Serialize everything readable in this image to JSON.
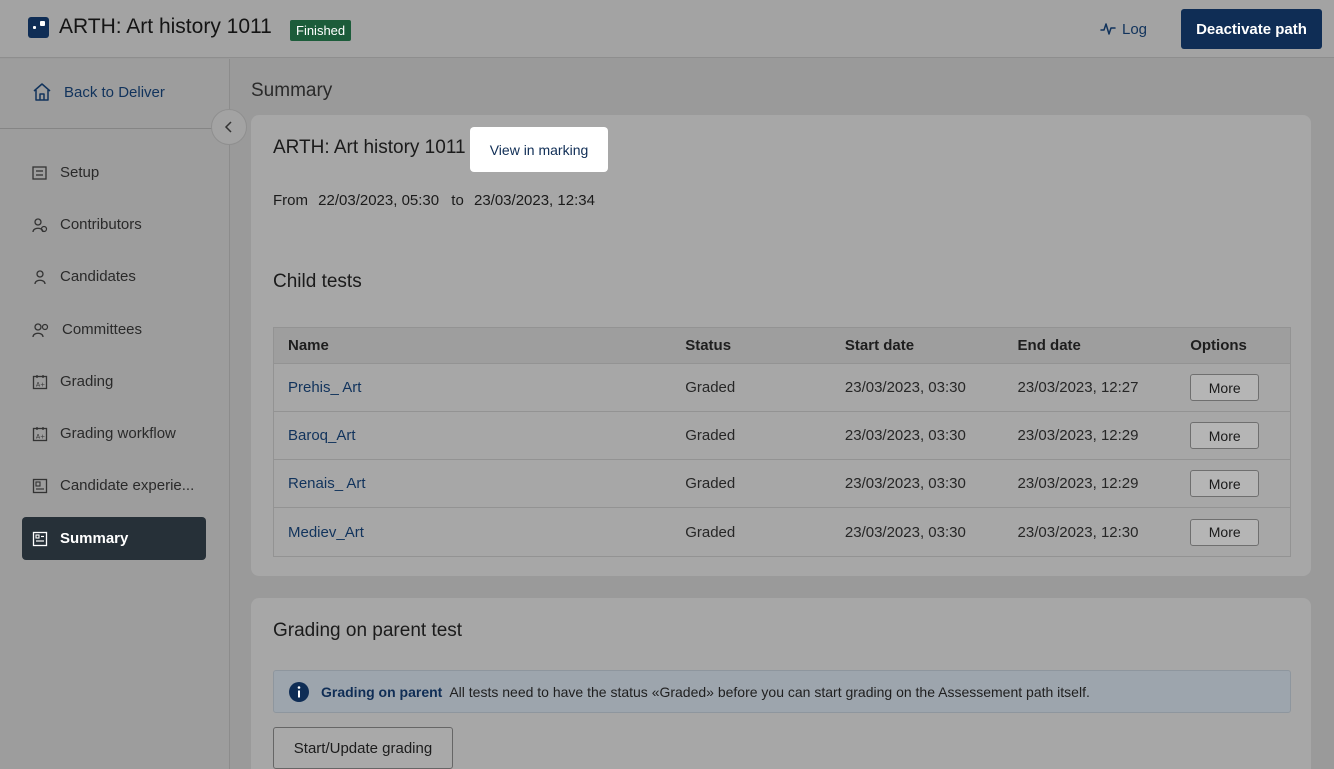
{
  "header": {
    "title": "ARTH: Art history 1011",
    "badge": "Finished",
    "log_label": "Log",
    "deactivate_label": "Deactivate path"
  },
  "sidebar": {
    "back_label": "Back to Deliver",
    "items": [
      {
        "label": "Setup",
        "icon": "setup-icon"
      },
      {
        "label": "Contributors",
        "icon": "contributors-icon"
      },
      {
        "label": "Candidates",
        "icon": "person-icon"
      },
      {
        "label": "Committees",
        "icon": "people-icon"
      },
      {
        "label": "Grading",
        "icon": "grading-calendar-icon"
      },
      {
        "label": "Grading workflow",
        "icon": "grading-calendar-icon"
      },
      {
        "label": "Candidate experie...",
        "icon": "candidate-experience-icon"
      },
      {
        "label": "Summary",
        "icon": "summary-icon",
        "active": true
      }
    ]
  },
  "main": {
    "title": "Summary",
    "test_card": {
      "title": "ARTH: Art history 1011",
      "view_marking_label": "View in marking",
      "from_label": "From",
      "from_date": "22/03/2023, 05:30",
      "to_label": "to",
      "to_date": "23/03/2023, 12:34"
    },
    "child_tests": {
      "heading": "Child tests",
      "columns": [
        "Name",
        "Status",
        "Start date",
        "End date",
        "Options"
      ],
      "rows": [
        {
          "name": "Prehis_ Art",
          "status": "Graded",
          "start": "23/03/2023, 03:30",
          "end": "23/03/2023, 12:27",
          "option": "More"
        },
        {
          "name": "Baroq_Art",
          "status": "Graded",
          "start": "23/03/2023, 03:30",
          "end": "23/03/2023, 12:29",
          "option": "More"
        },
        {
          "name": "Renais_ Art",
          "status": "Graded",
          "start": "23/03/2023, 03:30",
          "end": "23/03/2023, 12:29",
          "option": "More"
        },
        {
          "name": "Mediev_Art",
          "status": "Graded",
          "start": "23/03/2023, 03:30",
          "end": "23/03/2023, 12:30",
          "option": "More"
        }
      ]
    },
    "grading_parent": {
      "heading": "Grading on parent test",
      "info_title": "Grading on parent",
      "info_text": "All tests need to have the status «Graded» before you can start grading on the Assessement path itself.",
      "button_label": "Start/Update grading"
    }
  },
  "colors": {
    "brand": "#0f2d55",
    "badge_finished": "#1c5c3a",
    "active_nav": "#263038"
  }
}
